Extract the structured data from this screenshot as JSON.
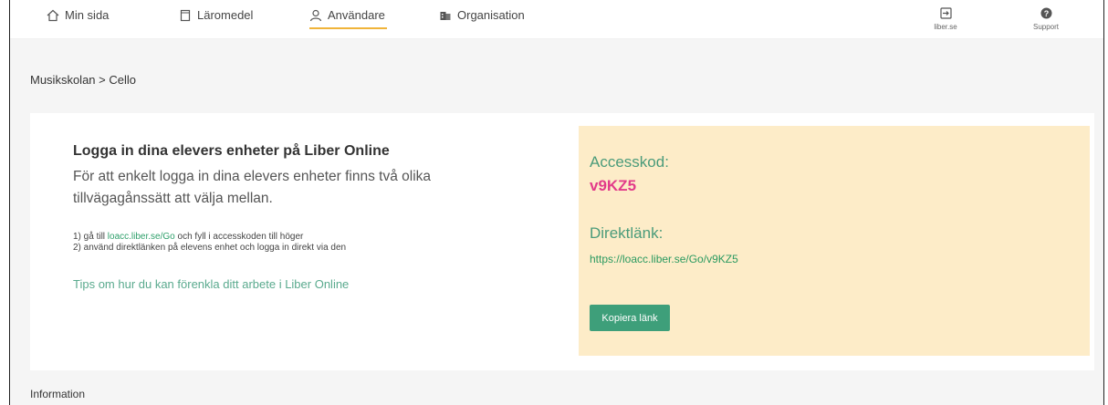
{
  "nav": {
    "items": [
      {
        "label": "Min sida",
        "icon": "home-icon"
      },
      {
        "label": "Läromedel",
        "icon": "book-icon"
      },
      {
        "label": "Användare",
        "icon": "user-icon"
      },
      {
        "label": "Organisation",
        "icon": "building-icon"
      }
    ],
    "active_index": 2,
    "right": [
      {
        "label": "liber.se",
        "icon": "exit-icon"
      },
      {
        "label": "Support",
        "icon": "help-icon"
      }
    ]
  },
  "breadcrumb": "Musikskolan > Cello",
  "login": {
    "title": "Logga in dina elevers enheter på Liber Online",
    "description": "För att enkelt logga in dina elevers enheter finns två olika tillvägagånssätt att välja mellan.",
    "step1_prefix": "1) gå till ",
    "step1_link": "loacc.liber.se/Go",
    "step1_suffix": " och fyll i accesskoden till höger",
    "step2": "2) använd direktlänken på elevens enhet och logga in direkt via den",
    "tips": "Tips om hur du kan förenkla ditt arbete i Liber Online"
  },
  "access": {
    "code_label": "Accesskod:",
    "code": "v9KZ5",
    "link_label": "Direktlänk:",
    "link": "https://loacc.liber.se/Go/v9KZ5",
    "copy_button": "Kopiera länk"
  },
  "info_heading": "Information",
  "colors": {
    "accent_green": "#3e9f7a",
    "code_pink": "#e23b8a",
    "panel_yellow": "#fdecc8",
    "active_underline": "#f0b43a"
  }
}
